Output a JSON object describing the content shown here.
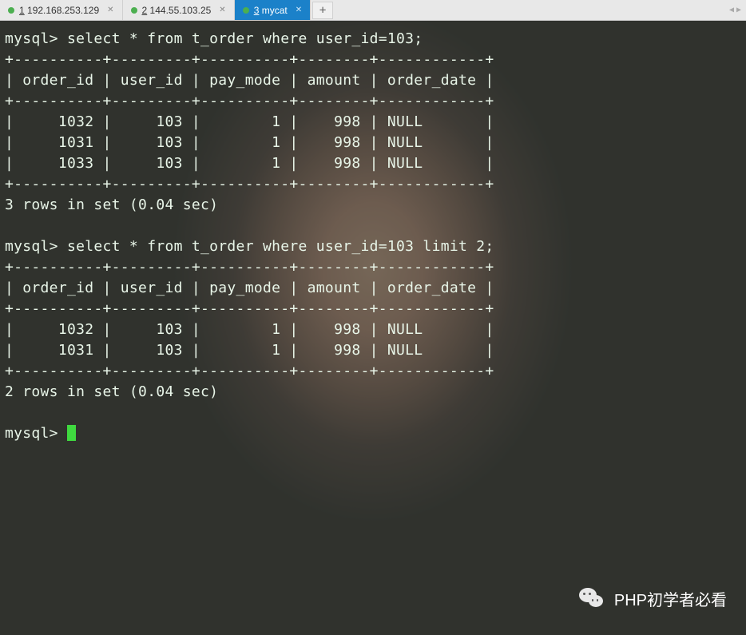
{
  "tabs": [
    {
      "num": "1",
      "label": "192.168.253.129",
      "active": false
    },
    {
      "num": "2",
      "label": "144.55.103.25",
      "active": false
    },
    {
      "num": "3",
      "label": "mycat",
      "active": true
    }
  ],
  "add_tab": "+",
  "terminal": {
    "prompt": "mysql>",
    "query1": {
      "sql": "select * from t_order where user_id=103;",
      "columns": [
        "order_id",
        "user_id",
        "pay_mode",
        "amount",
        "order_date"
      ],
      "rows": [
        {
          "order_id": "1032",
          "user_id": "103",
          "pay_mode": "1",
          "amount": "998",
          "order_date": "NULL"
        },
        {
          "order_id": "1031",
          "user_id": "103",
          "pay_mode": "1",
          "amount": "998",
          "order_date": "NULL"
        },
        {
          "order_id": "1033",
          "user_id": "103",
          "pay_mode": "1",
          "amount": "998",
          "order_date": "NULL"
        }
      ],
      "footer": "3 rows in set (0.04 sec)"
    },
    "query2": {
      "sql": "select * from t_order where user_id=103 limit 2;",
      "columns": [
        "order_id",
        "user_id",
        "pay_mode",
        "amount",
        "order_date"
      ],
      "rows": [
        {
          "order_id": "1032",
          "user_id": "103",
          "pay_mode": "1",
          "amount": "998",
          "order_date": "NULL"
        },
        {
          "order_id": "1031",
          "user_id": "103",
          "pay_mode": "1",
          "amount": "998",
          "order_date": "NULL"
        }
      ],
      "footer": "2 rows in set (0.04 sec)"
    }
  },
  "watermark": "PHP初学者必看"
}
